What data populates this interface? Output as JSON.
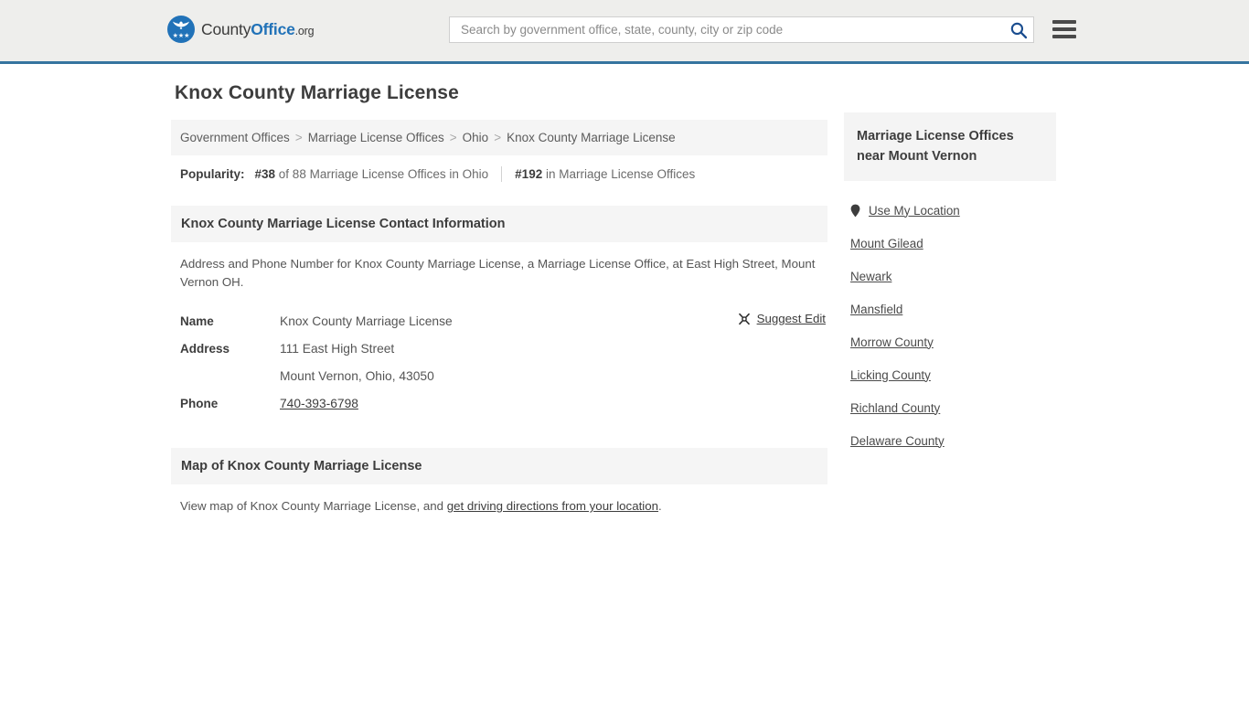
{
  "header": {
    "brand": {
      "part1": "County",
      "part2": "Office",
      "part3": ".org",
      "logo_icon": "eagle-seal-icon"
    },
    "search": {
      "placeholder": "Search by government office, state, county, city or zip code",
      "value": "",
      "search_icon": "search-icon"
    },
    "menu_icon": "hamburger-menu-icon"
  },
  "page": {
    "title": "Knox County Marriage License"
  },
  "breadcrumb": {
    "separator": ">",
    "items": [
      {
        "label": "Government Offices",
        "current": false
      },
      {
        "label": "Marriage License Offices",
        "current": false
      },
      {
        "label": "Ohio",
        "current": false
      },
      {
        "label": "Knox County Marriage License",
        "current": true
      }
    ]
  },
  "popularity": {
    "label": "Popularity:",
    "items": [
      {
        "rank": "#38",
        "text": " of 88 Marriage License Offices in Ohio"
      },
      {
        "rank": "#192",
        "text": " in Marriage License Offices"
      }
    ]
  },
  "contact": {
    "heading": "Knox County Marriage License Contact Information",
    "description": "Address and Phone Number for Knox County Marriage License, a Marriage License Office, at East High Street, Mount Vernon OH.",
    "rows": [
      {
        "label": "Name",
        "value": "Knox County Marriage License",
        "link": false
      },
      {
        "label": "Address",
        "value": "111 East High Street",
        "link": false
      },
      {
        "label": "",
        "value": "Mount Vernon, Ohio, 43050",
        "link": false
      },
      {
        "label": "Phone",
        "value": "740-393-6798",
        "link": true
      }
    ],
    "suggest_edit": {
      "label": "Suggest Edit",
      "icon": "edit-pencil-icon"
    }
  },
  "map": {
    "heading": "Map of Knox County Marriage License",
    "text_before": "View map of Knox County Marriage License, and ",
    "link": "get driving directions from your location",
    "text_after": "."
  },
  "sidebar": {
    "heading": "Marriage License Offices near Mount Vernon",
    "use_my_location": {
      "label": "Use My Location",
      "icon": "map-pin-icon"
    },
    "links": [
      {
        "label": "Mount Gilead"
      },
      {
        "label": "Newark"
      },
      {
        "label": "Mansfield"
      },
      {
        "label": "Morrow County"
      },
      {
        "label": "Licking County"
      },
      {
        "label": "Richland County"
      },
      {
        "label": "Delaware County"
      }
    ]
  },
  "colors": {
    "brand_blue": "#2172b8",
    "header_bg": "#eeeeec",
    "header_border": "#35749f",
    "band_bg": "#f5f5f5",
    "search_icon": "#1a4d8f",
    "text_dark": "#3d3d3d",
    "text_body": "#555555"
  }
}
